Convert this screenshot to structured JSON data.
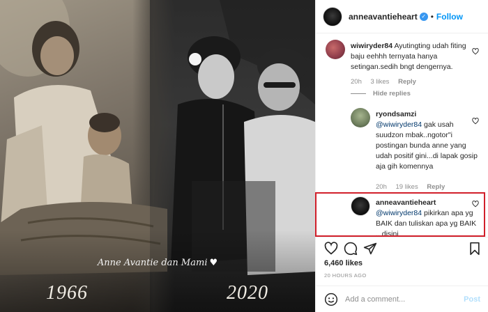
{
  "photo": {
    "caption": "Anne Avantie dan Mami",
    "year_left": "1966",
    "year_right": "2020"
  },
  "header": {
    "username": "anneavantieheart",
    "follow_label": "Follow",
    "separator": "•"
  },
  "comments": [
    {
      "username": "wiwiryder84",
      "text": "Ayutingting udah fiting baju eehhh ternyata hanya setingan.sedih bngt dengernya.",
      "time": "20h",
      "likes": "3 likes",
      "reply": "Reply"
    },
    {
      "username": "ryondsamzi",
      "mention": "@wiwiryder84",
      "text": "gak usah suudzon mbak..ngotor\"i postingan bunda anne yang udah positif gini...di lapak gosip aja gih komennya",
      "time": "20h",
      "likes": "19 likes",
      "reply": "Reply"
    },
    {
      "username": "anneavantieheart",
      "mention": "@wiwiryder84",
      "text": "pikirkan apa yg BAIK dan tuliskan apa yg BAIK .. disini"
    }
  ],
  "hide_replies_label": "Hide replies",
  "likes_count": "6,460 likes",
  "time_ago": "20 HOURS AGO",
  "add_comment": {
    "placeholder": "Add a comment...",
    "post_label": "Post"
  },
  "colors": {
    "follow": "#0095f6",
    "highlight_border": "#d11f2a",
    "verified": "#3897f0"
  }
}
